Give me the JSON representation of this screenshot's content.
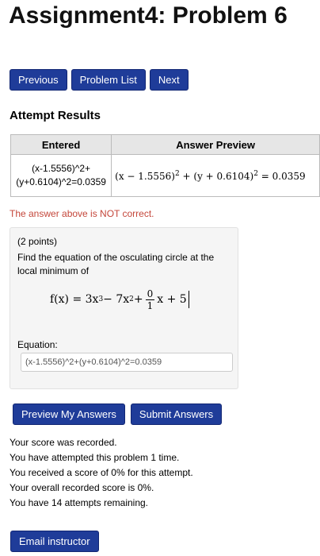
{
  "page": {
    "title": "Assignment4: Problem 6"
  },
  "nav": {
    "previous": "Previous",
    "problem_list": "Problem List",
    "next": "Next"
  },
  "attempt": {
    "heading": "Attempt Results",
    "col_entered": "Entered",
    "col_preview": "Answer Preview",
    "entered_line1": "(x-1.5556)^2+",
    "entered_line2": "(y+0.6104)^2=0.0359",
    "preview_a": "(x − 1.5556)",
    "preview_b": " + (y + 0.6104)",
    "preview_c": " = 0.0359",
    "exponent": "2",
    "incorrect_msg": "The answer above is NOT correct."
  },
  "problem": {
    "points": "(2 points)",
    "prompt": "Find the equation of the osculating circle at the local minimum of",
    "formula_lhs": "f(x) = 3x",
    "exp_3": "3",
    "formula_mid": " − 7x",
    "exp_2": "2",
    "plus1": " + ",
    "frac_num": "0",
    "frac_den": "1",
    "formula_tail": "x + 5",
    "equation_label": "Equation:",
    "answer_value": "(x-1.5556)^2+(y+0.6104)^2=0.0359"
  },
  "actions": {
    "preview": "Preview My Answers",
    "submit": "Submit Answers"
  },
  "status": {
    "recorded": "Your score was recorded.",
    "attempted": "You have attempted this problem 1 time.",
    "received": "You received a score of 0% for this attempt.",
    "overall": "Your overall recorded score is 0%.",
    "remaining": "You have 14 attempts remaining."
  },
  "footer": {
    "email": "Email instructor"
  },
  "colors": {
    "button_bg": "#1f3c99",
    "error_text": "#c4463a",
    "panel_bg": "#f5f5f5",
    "header_bg": "#e6e6e6"
  }
}
